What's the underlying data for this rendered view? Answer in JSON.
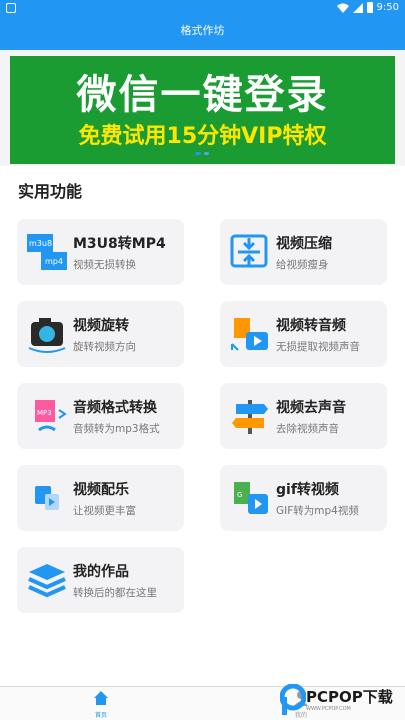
{
  "status_bar": {
    "time": "9:50"
  },
  "header": {
    "title": "格式作坊"
  },
  "banner": {
    "headline": "微信一键登录",
    "subline": "免费试用15分钟VIP特权"
  },
  "section": {
    "title": "实用功能"
  },
  "features": [
    {
      "title": "M3U8转MP4",
      "subtitle": "视频无损转换",
      "icon": "m3u8-to-mp4-icon",
      "icon_text_a": "m3u8",
      "icon_text_b": "mp4"
    },
    {
      "title": "视频压缩",
      "subtitle": "给视频瘦身",
      "icon": "compress-icon"
    },
    {
      "title": "视频旋转",
      "subtitle": "旋转视频方向",
      "icon": "camera-rotate-icon"
    },
    {
      "title": "视频转音频",
      "subtitle": "无损提取视频声音",
      "icon": "video-to-audio-icon"
    },
    {
      "title": "音频格式转换",
      "subtitle": "音频转为mp3格式",
      "icon": "audio-convert-icon"
    },
    {
      "title": "视频去声音",
      "subtitle": "去除视频声音",
      "icon": "signpost-icon"
    },
    {
      "title": "视频配乐",
      "subtitle": "让视频更丰富",
      "icon": "video-music-icon"
    },
    {
      "title": "gif转视频",
      "subtitle": "GIF转为mp4视频",
      "icon": "gif-to-video-icon"
    },
    {
      "title": "我的作品",
      "subtitle": "转换后的都在这里",
      "icon": "layers-icon"
    }
  ],
  "bottom_nav": {
    "home": "首页",
    "mine": "我的"
  },
  "watermark": {
    "text": "PCPOP下载",
    "sub": "WWW.PCPOP.COM"
  },
  "colors": {
    "primary": "#2196f3",
    "banner_bg": "#1a9c33",
    "banner_sub": "#ffe600"
  }
}
